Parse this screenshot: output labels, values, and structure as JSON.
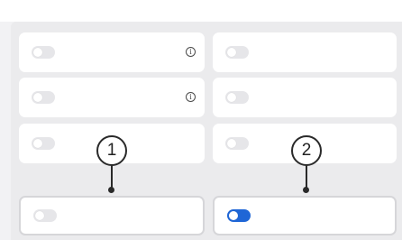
{
  "panel": {
    "cards": [
      {
        "toggle": "off",
        "info_icon": "info-icon",
        "info_glyph": "i"
      },
      {
        "toggle": "off"
      },
      {
        "toggle": "off",
        "info_icon": "info-icon",
        "info_glyph": "i"
      },
      {
        "toggle": "off"
      },
      {
        "toggle": "off"
      },
      {
        "toggle": "off"
      },
      {
        "toggle": "off",
        "outlined": true
      },
      {
        "toggle": "on",
        "outlined": true
      }
    ]
  },
  "callouts": [
    {
      "label": "1"
    },
    {
      "label": "2"
    }
  ],
  "colors": {
    "toggle_on": "#1f66d6",
    "toggle_off": "#e6e6e9",
    "card": "#ffffff",
    "background": "#ebebed"
  }
}
